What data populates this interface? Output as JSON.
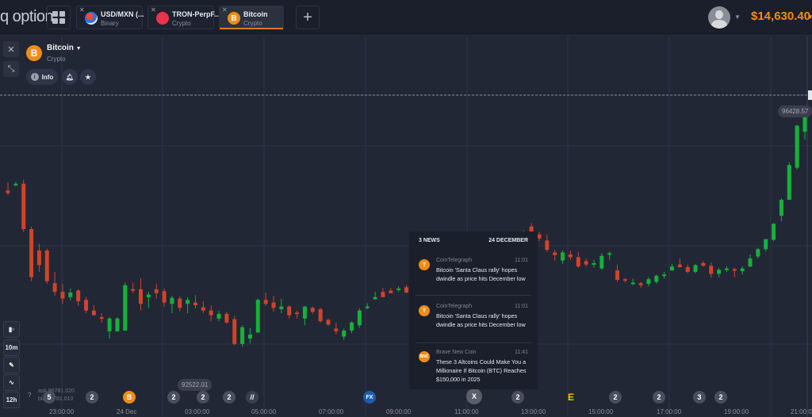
{
  "app": {
    "logo": "q option"
  },
  "tabs": [
    {
      "title": "USD/MXN (...",
      "subtitle": "Binary",
      "icon": "usd-mxn-flag-icon",
      "active": false
    },
    {
      "title": "TRON-PerpF...",
      "subtitle": "Crypto",
      "icon": "tron-icon",
      "active": false
    },
    {
      "title": "Bitcoin",
      "subtitle": "Crypto",
      "icon": "bitcoin-icon",
      "active": true
    }
  ],
  "header": {
    "balance": "$14,630.40"
  },
  "asset": {
    "name": "Bitcoin",
    "type": "Crypto",
    "icon_letter": "B",
    "info_label": "Info"
  },
  "tools": {
    "chart_type": "candles",
    "interval": "10m",
    "period": "12h"
  },
  "price": {
    "current": "96428.57",
    "low_marker": "92522.01",
    "ask": "ask 96781.020",
    "bid": "bid 96781.010"
  },
  "timeline": {
    "labels": [
      "23:00:00",
      "24 Dec",
      "03:00:00",
      "05:00:00",
      "07:00:00",
      "09:00:00",
      "11:00:00",
      "13:00:00",
      "15:00:00",
      "17:00:00",
      "19:00:00",
      "21:00:00"
    ],
    "badges": [
      "5",
      "2",
      "B",
      "2",
      "2",
      "2",
      "//",
      "FX",
      "X",
      "2",
      "E",
      "2",
      "2",
      "3",
      "2"
    ]
  },
  "news": {
    "count_label": "3 NEWS",
    "date": "24 DECEMBER",
    "items": [
      {
        "source": "CoinTelegraph",
        "time": "11:01",
        "headline": "Bitcoin 'Santa Claus rally' hopes dwindle as price hits December low",
        "icon": "T"
      },
      {
        "source": "CoinTelegraph",
        "time": "11:01",
        "headline": "Bitcoin 'Santa Claus rally' hopes dwindle as price hits December low",
        "icon": "T"
      },
      {
        "source": "Brave New Coin",
        "time": "11:41",
        "headline": "These 3 Altcoins Could Make You a Millionaire If Bitcoin (BTC) Reaches $150,000 in 2025",
        "icon": "BNC"
      }
    ]
  },
  "colors": {
    "up": "#14b23a",
    "down": "#d2432a",
    "accent": "#f08c16",
    "background": "#222736"
  },
  "chart_data": {
    "type": "candlestick",
    "title": "Bitcoin",
    "price_range": [
      92300,
      96600
    ],
    "candles": [
      [
        95220,
        95340,
        95150,
        95180
      ],
      [
        95300,
        95350,
        95280,
        95320
      ],
      [
        95320,
        95380,
        94600,
        94640
      ],
      [
        94640,
        94680,
        93860,
        93920
      ],
      [
        94320,
        94420,
        94000,
        94100
      ],
      [
        94320,
        94350,
        93820,
        93860
      ],
      [
        93830,
        94000,
        93640,
        93700
      ],
      [
        93700,
        93820,
        93520,
        93600
      ],
      [
        93620,
        93750,
        93570,
        93690
      ],
      [
        93720,
        93740,
        93490,
        93560
      ],
      [
        93580,
        93630,
        93380,
        93420
      ],
      [
        93420,
        93500,
        93340,
        93350
      ],
      [
        93320,
        93380,
        93240,
        93300
      ],
      [
        93110,
        93320,
        93000,
        93300
      ],
      [
        93110,
        93320,
        93100,
        93300
      ],
      [
        93120,
        93840,
        93120,
        93800
      ],
      [
        93740,
        93840,
        93680,
        93720
      ],
      [
        93740,
        93900,
        93420,
        93520
      ],
      [
        93620,
        93700,
        93460,
        93660
      ],
      [
        93740,
        93820,
        93600,
        93680
      ],
      [
        93710,
        93750,
        93480,
        93540
      ],
      [
        93520,
        93640,
        93380,
        93610
      ],
      [
        93600,
        93630,
        93410,
        93460
      ],
      [
        93520,
        93620,
        93380,
        93580
      ],
      [
        93540,
        93650,
        93450,
        93500
      ],
      [
        93470,
        93560,
        93380,
        93420
      ],
      [
        93420,
        93500,
        93260,
        93350
      ],
      [
        93300,
        93420,
        93260,
        93370
      ],
      [
        93370,
        93400,
        93220,
        93240
      ],
      [
        93290,
        93340,
        92900,
        92920
      ],
      [
        92920,
        93200,
        92880,
        93170
      ],
      [
        93000,
        93160,
        92930,
        93060
      ],
      [
        93090,
        93600,
        93090,
        93580
      ],
      [
        93580,
        93690,
        93490,
        93520
      ],
      [
        93540,
        93640,
        93400,
        93460
      ],
      [
        93440,
        93600,
        93380,
        93480
      ],
      [
        93480,
        93500,
        93300,
        93350
      ],
      [
        93390,
        93420,
        93300,
        93370
      ],
      [
        93300,
        93490,
        93200,
        93480
      ],
      [
        93460,
        93480,
        93370,
        93400
      ],
      [
        93440,
        93460,
        93240,
        93260
      ],
      [
        93280,
        93300,
        93190,
        93210
      ],
      [
        93150,
        93240,
        93060,
        93110
      ],
      [
        93030,
        93150,
        92980,
        93120
      ],
      [
        93120,
        93260,
        93080,
        93240
      ],
      [
        93200,
        93450,
        93160,
        93420
      ],
      [
        93470,
        93530,
        93440,
        93480
      ],
      [
        93590,
        93700,
        93580,
        93620
      ],
      [
        93700,
        93760,
        93650,
        93620
      ],
      [
        93720,
        93760,
        93720,
        93680
      ],
      [
        93740,
        93780,
        93700,
        93750
      ],
      [
        93770,
        93800,
        93680,
        93690
      ],
      [
        93700,
        93740,
        93600,
        93620
      ],
      [
        93610,
        93630,
        93350,
        93350
      ],
      [
        93380,
        93500,
        93300,
        93460
      ],
      [
        93530,
        93650,
        93500,
        93600
      ],
      [
        93640,
        93680,
        93560,
        93580
      ],
      [
        93560,
        93600,
        93520,
        93540
      ],
      [
        93600,
        93780,
        93500,
        93760
      ],
      [
        93880,
        94000,
        93860,
        93960
      ],
      [
        94040,
        94120,
        94010,
        94080
      ],
      [
        94160,
        94230,
        93980,
        94040
      ],
      [
        94040,
        94080,
        93940,
        93960
      ],
      [
        94000,
        94320,
        93920,
        94310
      ],
      [
        94290,
        94390,
        94130,
        94240
      ],
      [
        94240,
        94280,
        94160,
        94170
      ],
      [
        94250,
        94620,
        94200,
        94580
      ],
      [
        94680,
        94730,
        94500,
        94560
      ],
      [
        94560,
        94600,
        94460,
        94500
      ],
      [
        94470,
        94560,
        94300,
        94330
      ],
      [
        94290,
        94330,
        94170,
        94250
      ],
      [
        94170,
        94320,
        94120,
        94290
      ],
      [
        94260,
        94320,
        94180,
        94220
      ],
      [
        94220,
        94300,
        94060,
        94080
      ],
      [
        94160,
        94200,
        94080,
        94110
      ],
      [
        94120,
        94180,
        94060,
        94130
      ],
      [
        94050,
        94280,
        94030,
        94240
      ],
      [
        94260,
        94300,
        94180,
        94280
      ],
      [
        94020,
        94110,
        93850,
        93880
      ],
      [
        93890,
        93910,
        93840,
        93880
      ],
      [
        93840,
        93900,
        93800,
        93840
      ],
      [
        93830,
        93850,
        93760,
        93800
      ],
      [
        93820,
        93920,
        93780,
        93890
      ],
      [
        93850,
        93960,
        93820,
        93940
      ],
      [
        93940,
        94000,
        93900,
        93960
      ],
      [
        94020,
        94120,
        94020,
        94080
      ],
      [
        94110,
        94200,
        94060,
        94070
      ],
      [
        94070,
        94110,
        93980,
        94000
      ],
      [
        94000,
        94120,
        93980,
        94100
      ],
      [
        94130,
        94160,
        94080,
        94090
      ],
      [
        94090,
        94140,
        93910,
        93970
      ],
      [
        93970,
        94060,
        93920,
        94030
      ],
      [
        94030,
        94080,
        94000,
        94050
      ],
      [
        94040,
        94060,
        93920,
        94020
      ],
      [
        94010,
        94080,
        93960,
        94050
      ],
      [
        94080,
        94260,
        94070,
        94200
      ],
      [
        94230,
        94360,
        94200,
        94340
      ],
      [
        94340,
        94470,
        94310,
        94490
      ],
      [
        94480,
        94730,
        94460,
        94720
      ],
      [
        94840,
        95100,
        94760,
        95080
      ],
      [
        95080,
        95640,
        95080,
        95600
      ],
      [
        95560,
        96200,
        95530,
        96190
      ],
      [
        96100,
        96480,
        95980,
        96440
      ]
    ]
  }
}
